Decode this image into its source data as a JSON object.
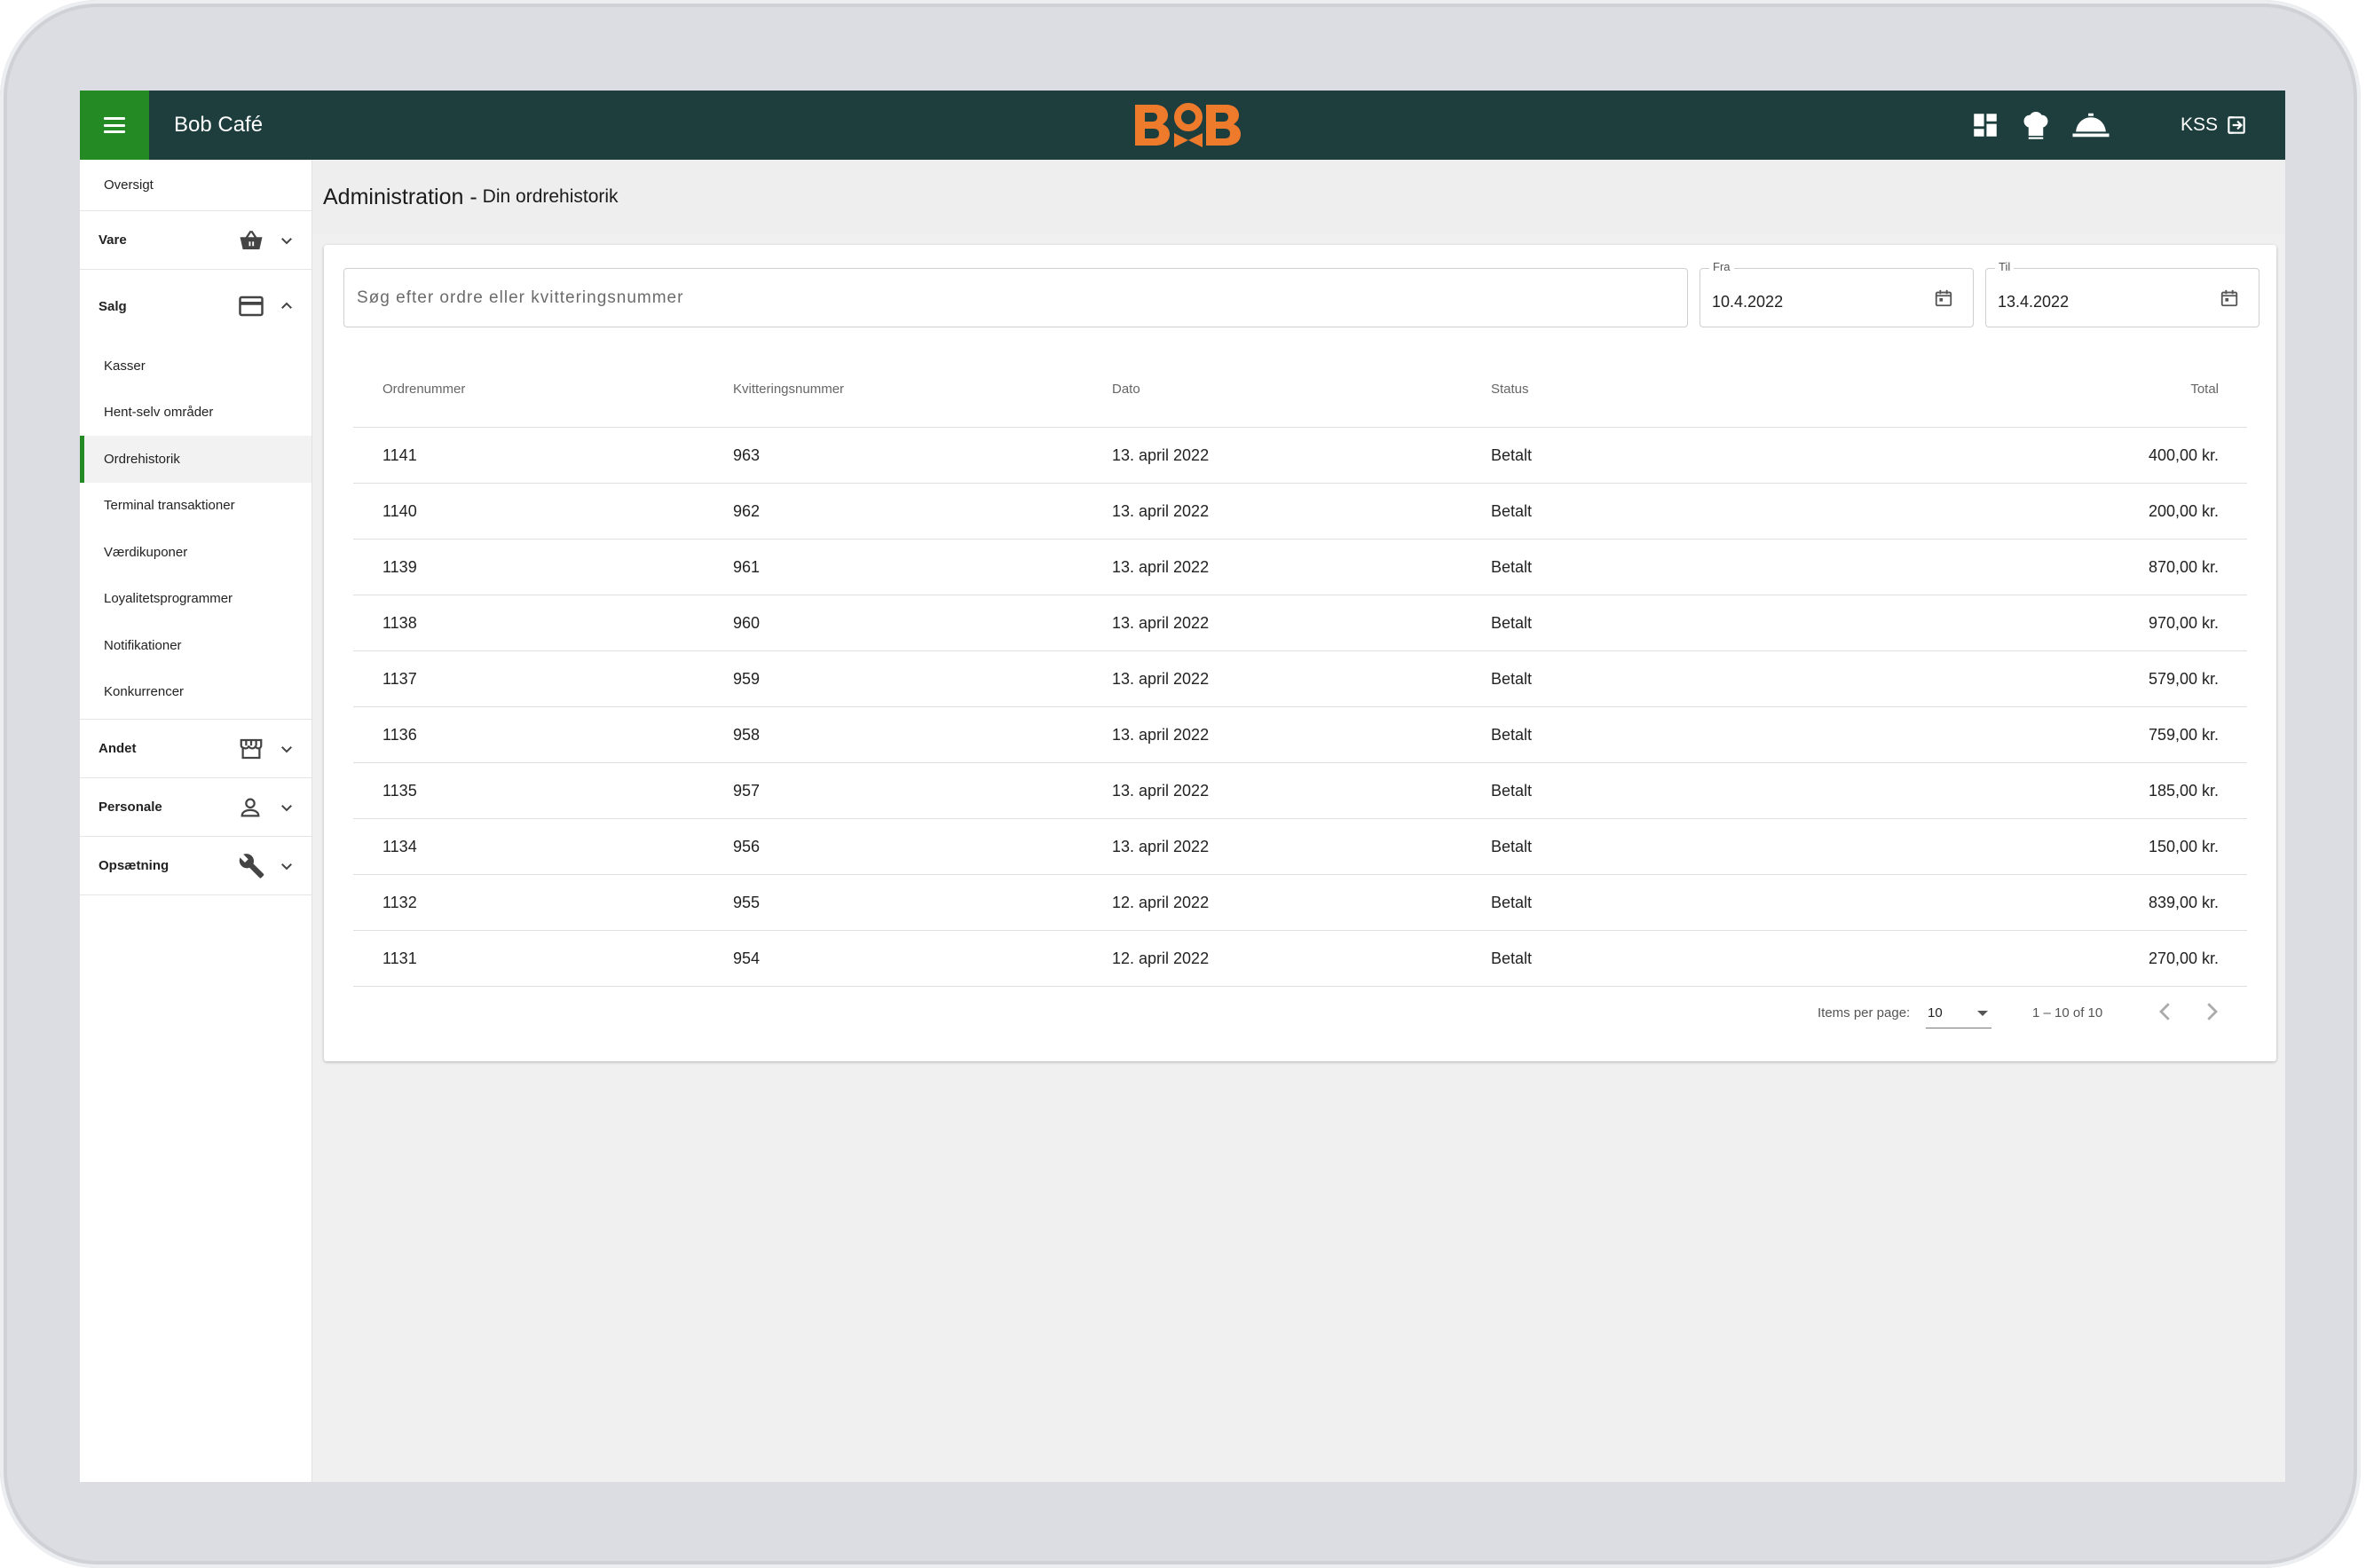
{
  "app": {
    "title": "Bob Café",
    "logo_text": "BOB",
    "user": "KSS"
  },
  "colors": {
    "topbar": "#1e3d3d",
    "accent_green": "#248a24",
    "logo_orange": "#ee7a2c"
  },
  "topbar_icons": [
    "dashboard-icon",
    "chef-hat-icon",
    "service-bell-icon",
    "logout-icon"
  ],
  "sidebar": {
    "top_item": "Oversigt",
    "vare": "Vare",
    "salg": "Salg",
    "salg_items": [
      "Kasser",
      "Hent-selv områder",
      "Ordrehistorik",
      "Terminal transaktioner",
      "Værdikuponer",
      "Loyalitetsprogrammer",
      "Notifikationer",
      "Konkurrencer"
    ],
    "active_item": "Ordrehistorik",
    "andet": "Andet",
    "personale": "Personale",
    "opsaetning": "Opsætning"
  },
  "header": {
    "title": "Administration -",
    "subtitle": "Din ordrehistorik"
  },
  "search": {
    "placeholder": "Søg efter ordre eller kvitteringsnummer",
    "value": ""
  },
  "date_from": {
    "label": "Fra",
    "value": "10.4.2022"
  },
  "date_to": {
    "label": "Til",
    "value": "13.4.2022"
  },
  "table": {
    "headers": [
      "Ordrenummer",
      "Kvitteringsnummer",
      "Dato",
      "Status",
      "Total"
    ],
    "rows": [
      [
        "1141",
        "963",
        "13. april 2022",
        "Betalt",
        "400,00 kr."
      ],
      [
        "1140",
        "962",
        "13. april 2022",
        "Betalt",
        "200,00 kr."
      ],
      [
        "1139",
        "961",
        "13. april 2022",
        "Betalt",
        "870,00 kr."
      ],
      [
        "1138",
        "960",
        "13. april 2022",
        "Betalt",
        "970,00 kr."
      ],
      [
        "1137",
        "959",
        "13. april 2022",
        "Betalt",
        "579,00 kr."
      ],
      [
        "1136",
        "958",
        "13. april 2022",
        "Betalt",
        "759,00 kr."
      ],
      [
        "1135",
        "957",
        "13. april 2022",
        "Betalt",
        "185,00 kr."
      ],
      [
        "1134",
        "956",
        "13. april 2022",
        "Betalt",
        "150,00 kr."
      ],
      [
        "1132",
        "955",
        "12. april 2022",
        "Betalt",
        "839,00 kr."
      ],
      [
        "1131",
        "954",
        "12. april 2022",
        "Betalt",
        "270,00 kr."
      ]
    ]
  },
  "paginator": {
    "label": "Items per page:",
    "page_size": "10",
    "range": "1 – 10 of 10"
  }
}
